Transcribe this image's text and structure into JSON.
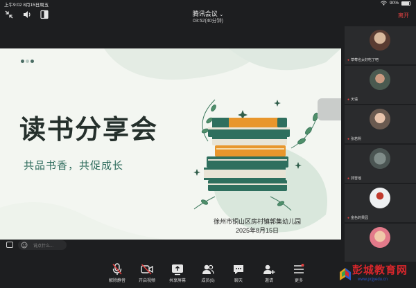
{
  "status_bar": {
    "time_date": "上午9:02   8月15日周五",
    "battery_percent": "90%",
    "battery_level": 0.9
  },
  "meeting": {
    "title": "腾讯会议",
    "duration": "03:52(40分钟)",
    "leave_label": "离开"
  },
  "slide": {
    "title": "读书分享会",
    "subtitle": "共品书香，共促成长",
    "org": "徐州市铜山区房村镇郭集幼儿园",
    "date": "2025年8月15日"
  },
  "chat": {
    "placeholder": "说点什么..."
  },
  "participants": [
    {
      "name": "草莓也太好吃了吧",
      "avatar_color": "#7b5a4a"
    },
    {
      "name": "天语",
      "avatar_color": "#8f7a6a"
    },
    {
      "name": "张若熙",
      "avatar_color": "#a88f80"
    },
    {
      "name": "郭雪瑶",
      "avatar_color": "#6e7c78"
    },
    {
      "name": "金色的果园",
      "avatar_color": "#c9cdd2"
    },
    {
      "name": "",
      "avatar_color": "#d9b49a"
    }
  ],
  "toolbar": [
    {
      "label": "解除静音",
      "icon": "mic-muted-icon"
    },
    {
      "label": "开启视频",
      "icon": "video-off-icon"
    },
    {
      "label": "共享屏幕",
      "icon": "share-screen-icon"
    },
    {
      "label": "成员(6)",
      "icon": "members-icon"
    },
    {
      "label": "聊天",
      "icon": "chat-icon"
    },
    {
      "label": "邀请",
      "icon": "invite-icon"
    },
    {
      "label": "更多",
      "icon": "more-icon"
    }
  ],
  "watermark": {
    "title": "彭城教育网",
    "url": "www.pcjyedu.cn"
  },
  "colors": {
    "accent_red": "#e34141",
    "slide_green": "#2d6b5c",
    "book_orange": "#e8962c"
  }
}
